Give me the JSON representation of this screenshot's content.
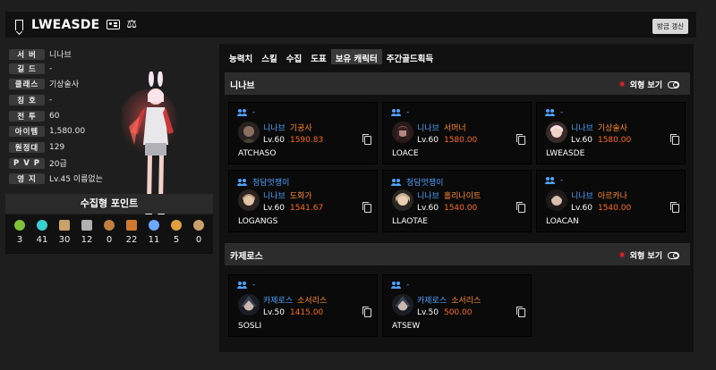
{
  "header": {
    "character_name": "LWEASDE",
    "refresh_label": "방금 갱신",
    "bookmark_icon": "bookmark-icon",
    "card_icon": "id-card-icon",
    "scale_icon": "scale-icon"
  },
  "profile": {
    "rows": [
      {
        "label": "서 버",
        "value": "니나브"
      },
      {
        "label": "길 드",
        "value": "-"
      },
      {
        "label": "클래스",
        "value": "기상술사"
      },
      {
        "label": "칭 호",
        "value": "-"
      },
      {
        "label": "전 투",
        "value": "60"
      },
      {
        "label": "아이템",
        "value": "1,580.00"
      },
      {
        "label": "원정대",
        "value": "129"
      },
      {
        "label": "P V P",
        "value": "20급"
      },
      {
        "label": "영 지",
        "value": "Lv.45 이름없는"
      }
    ]
  },
  "collection": {
    "title": "수집형 포인트",
    "items": [
      {
        "icon": "island-heart-icon",
        "color": "#7fbf3a",
        "value": "3"
      },
      {
        "icon": "orpheus-star-icon",
        "color": "#3ad0d0",
        "value": "41"
      },
      {
        "icon": "giant-heart-icon",
        "color": "#c9a26a",
        "value": "30"
      },
      {
        "icon": "art-icon",
        "color": "#b0b0b0",
        "value": "12"
      },
      {
        "icon": "mokoko-seed-icon",
        "color": "#c08040",
        "value": "0"
      },
      {
        "icon": "voyage-icon",
        "color": "#d07a30",
        "value": "22"
      },
      {
        "icon": "world-tree-leaf-icon",
        "color": "#6fa8ff",
        "value": "11"
      },
      {
        "icon": "ignea-token-icon",
        "color": "#e0a040",
        "value": "5"
      },
      {
        "icon": "orpheus-medal-icon",
        "color": "#c9a26a",
        "value": "0"
      }
    ]
  },
  "tabs": [
    {
      "label": "능력치",
      "active": false
    },
    {
      "label": "스킬",
      "active": false
    },
    {
      "label": "수집",
      "active": false
    },
    {
      "label": "도표",
      "active": false
    },
    {
      "label": "보유 캐릭터",
      "active": true
    },
    {
      "label": "주간골드획득",
      "active": false
    }
  ],
  "servers": [
    {
      "name": "니나브",
      "view_label": "외형 보기",
      "characters": [
        {
          "guild": "-",
          "server": "니나브",
          "class": "기공사",
          "level": "Lv.60",
          "item_level": "1590.83",
          "name": "ATCHASO",
          "face": "#8a7060"
        },
        {
          "guild": "-",
          "server": "니나브",
          "class": "서머너",
          "level": "Lv.60",
          "item_level": "1580.00",
          "name": "LOACE",
          "face": "#6a5050"
        },
        {
          "guild": "-",
          "server": "니나브",
          "class": "기상술사",
          "level": "Lv.60",
          "item_level": "1580.00",
          "name": "LWEASDE",
          "face": "#e0b0b0"
        },
        {
          "guild": "청담엇쟁이",
          "server": "니나브",
          "class": "도화가",
          "level": "Lv.60",
          "item_level": "1541.67",
          "name": "LOGANGS",
          "face": "#b09070"
        },
        {
          "guild": "청담엇쟁이",
          "server": "니나브",
          "class": "홀리나이트",
          "level": "Lv.60",
          "item_level": "1540.00",
          "name": "LLAOTAE",
          "face": "#c0a080"
        },
        {
          "guild": "-",
          "server": "니나브",
          "class": "아르카나",
          "level": "Lv.60",
          "item_level": "1540.00",
          "name": "LOACAN",
          "face": "#907060"
        }
      ]
    },
    {
      "name": "카제로스",
      "view_label": "외형 보기",
      "characters": [
        {
          "guild": "-",
          "server": "카제로스",
          "class": "소서리스",
          "level": "Lv.50",
          "item_level": "1415.00",
          "name": "SOSLI",
          "face": "#5a6070"
        },
        {
          "guild": "-",
          "server": "카제로스",
          "class": "소서리스",
          "level": "Lv.50",
          "item_level": "500.00",
          "name": "ATSEW",
          "face": "#5a6070"
        }
      ]
    }
  ]
}
